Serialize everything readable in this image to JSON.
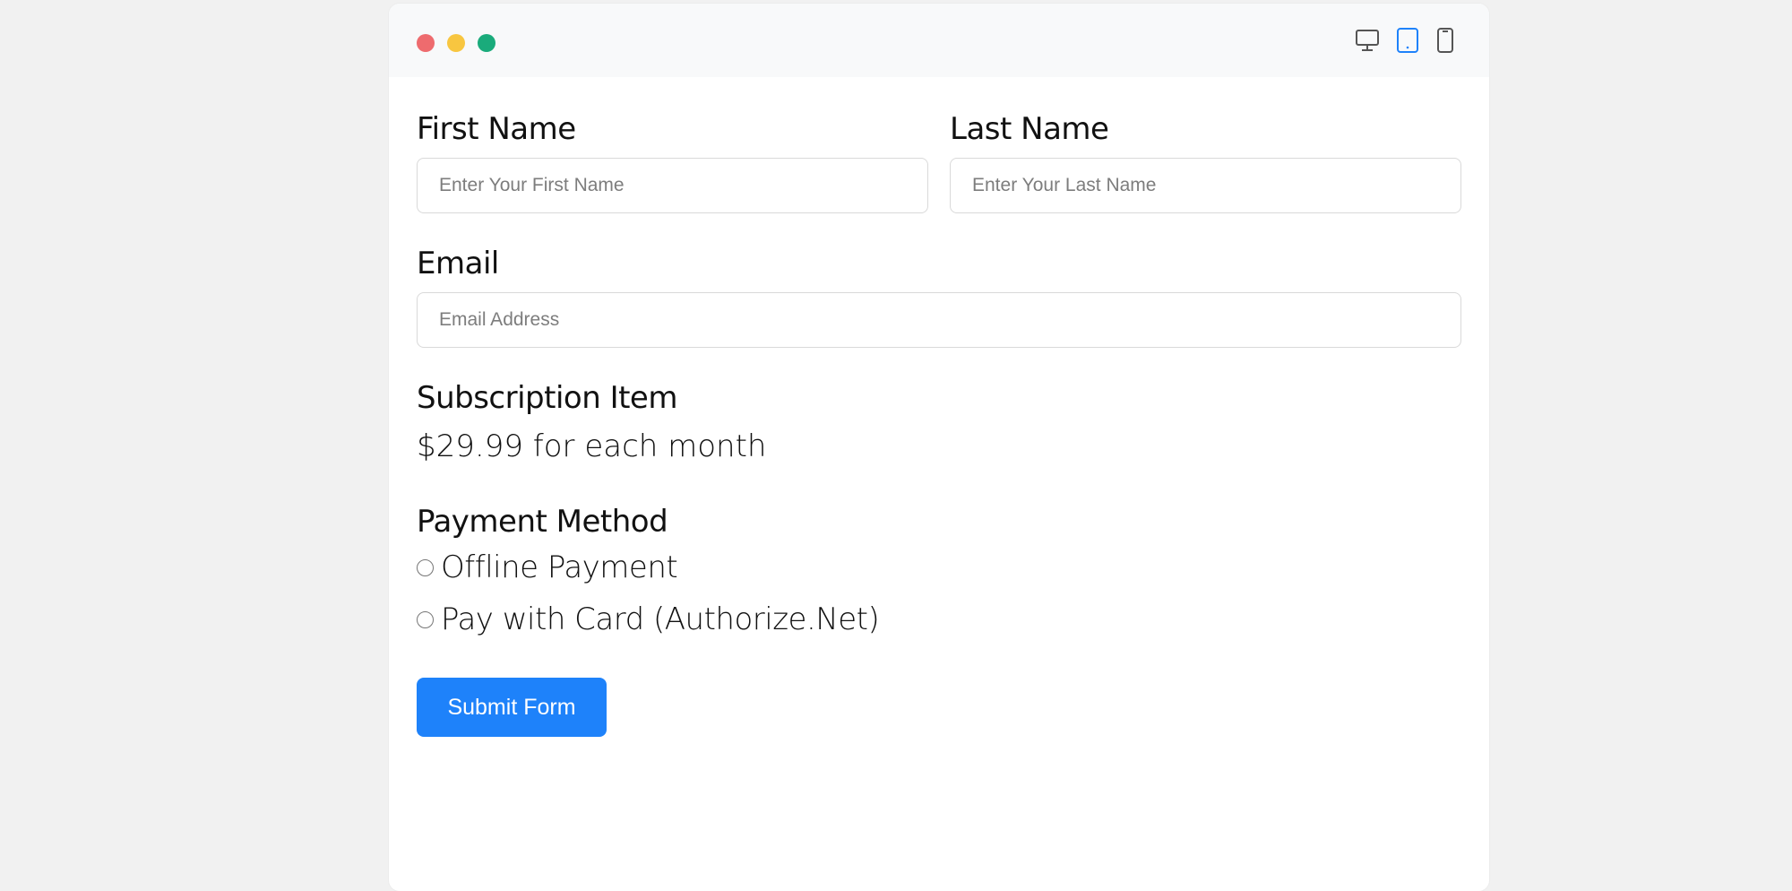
{
  "window": {
    "controls": [
      "close-dot",
      "minimize-dot",
      "maximize-dot"
    ],
    "device_toggles": [
      {
        "icon": "desktop-icon",
        "active": false
      },
      {
        "icon": "tablet-icon",
        "active": true
      },
      {
        "icon": "mobile-icon",
        "active": false
      }
    ],
    "accent_color": "#1e82fa"
  },
  "form": {
    "first_name": {
      "label": "First Name",
      "placeholder": "Enter Your First Name",
      "value": ""
    },
    "last_name": {
      "label": "Last Name",
      "placeholder": "Enter Your Last Name",
      "value": ""
    },
    "email": {
      "label": "Email",
      "placeholder": "Email Address",
      "value": ""
    },
    "subscription": {
      "label": "Subscription Item",
      "price_text": "$29.99 for each month"
    },
    "payment": {
      "label": "Payment Method",
      "options": [
        {
          "label": "Offline Payment",
          "selected": false
        },
        {
          "label": "Pay with Card (Authorize.Net)",
          "selected": false
        }
      ]
    },
    "submit_label": "Submit Form"
  }
}
